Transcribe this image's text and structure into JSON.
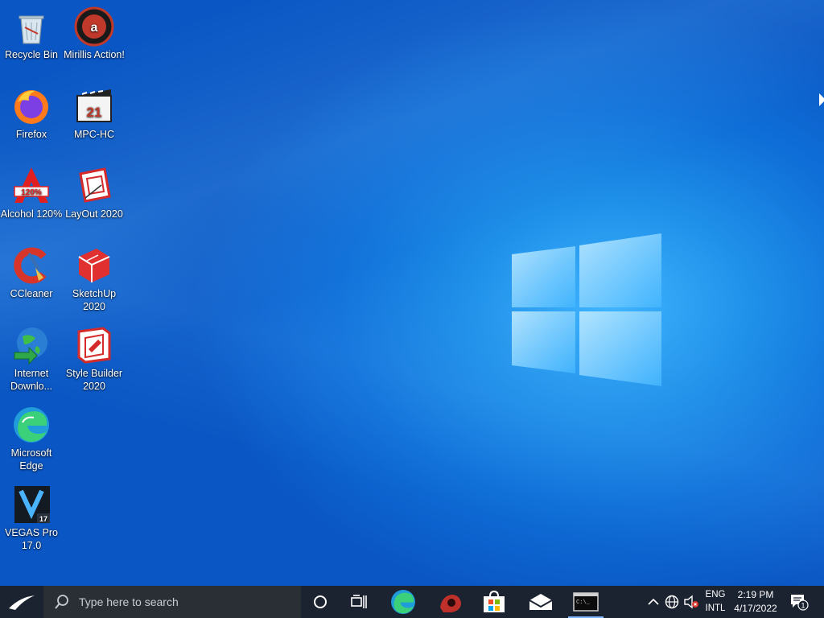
{
  "desktop": {
    "icons": [
      {
        "label": "Recycle Bin",
        "icon": "recycle-bin-icon"
      },
      {
        "label": "Mirillis Action!",
        "icon": "mirillis-action-icon"
      },
      {
        "label": "Firefox",
        "icon": "firefox-icon"
      },
      {
        "label": "MPC-HC",
        "icon": "mpc-hc-icon"
      },
      {
        "label": "Alcohol 120%",
        "icon": "alcohol-120-icon"
      },
      {
        "label": "LayOut 2020",
        "icon": "layout-2020-icon"
      },
      {
        "label": "CCleaner",
        "icon": "ccleaner-icon"
      },
      {
        "label": "SketchUp 2020",
        "icon": "sketchup-2020-icon"
      },
      {
        "label": "Internet Downlo...",
        "icon": "internet-download-manager-icon"
      },
      {
        "label": "Style Builder 2020",
        "icon": "style-builder-2020-icon"
      },
      {
        "label": "Microsoft Edge",
        "icon": "microsoft-edge-icon"
      },
      {
        "label": "VEGAS Pro 17.0",
        "icon": "vegas-pro-17-icon"
      }
    ]
  },
  "taskbar": {
    "search_placeholder": "Type here to search",
    "pinned": [
      {
        "name": "cortana",
        "icon": "cortana-circle-icon"
      },
      {
        "name": "task-view",
        "icon": "task-view-icon"
      },
      {
        "name": "edge",
        "icon": "microsoft-edge-icon"
      },
      {
        "name": "mirillis-action",
        "icon": "mirillis-action-icon"
      },
      {
        "name": "microsoft-store",
        "icon": "store-bag-icon"
      },
      {
        "name": "mail",
        "icon": "mail-envelope-icon"
      },
      {
        "name": "command-prompt",
        "icon": "cmd-icon"
      }
    ],
    "tray": {
      "lang_top": "ENG",
      "lang_bottom": "INTL",
      "time": "2:19 PM",
      "date": "4/17/2022",
      "notification_count": "1"
    }
  },
  "colors": {
    "wallpaper": "#0f6fd8",
    "taskbar": "#1b2230",
    "search_box": "#2a2f36",
    "active_underline": "#7fb8ff"
  }
}
